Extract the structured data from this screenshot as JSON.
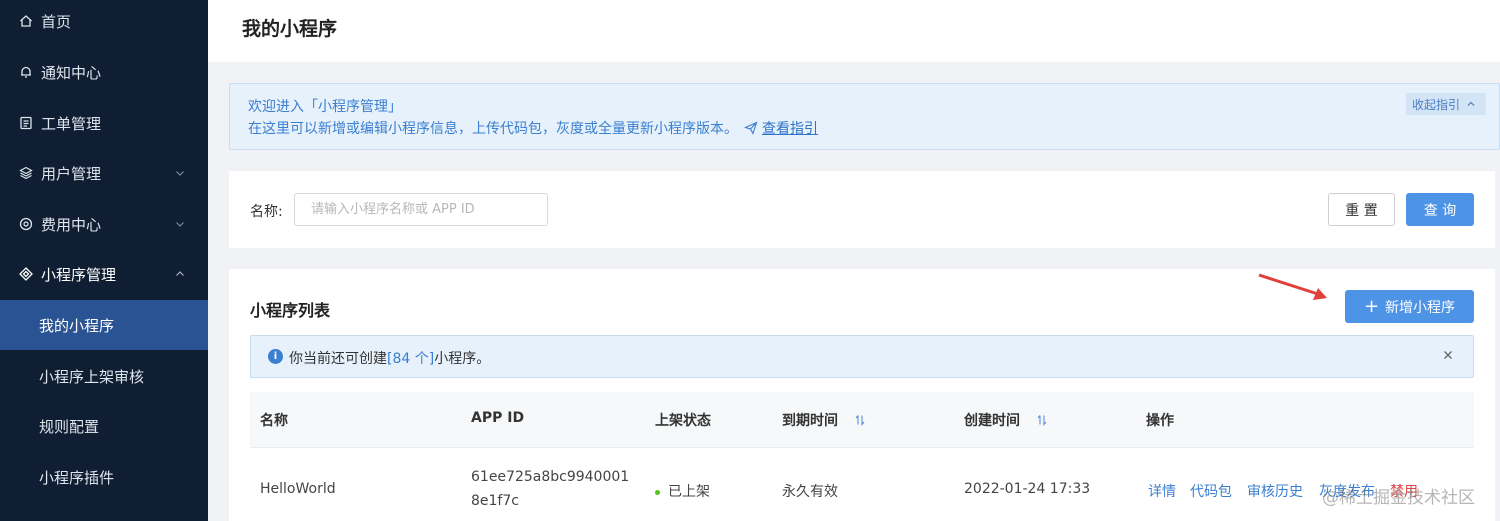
{
  "sidebar": {
    "items": [
      {
        "label": "首页",
        "icon": "home-icon"
      },
      {
        "label": "通知中心",
        "icon": "bell-icon"
      },
      {
        "label": "工单管理",
        "icon": "ticket-icon"
      },
      {
        "label": "用户管理",
        "icon": "layers-icon"
      },
      {
        "label": "费用中心",
        "icon": "coin-icon"
      },
      {
        "label": "小程序管理",
        "icon": "miniapp-icon"
      }
    ],
    "sub_items": [
      {
        "label": "我的小程序"
      },
      {
        "label": "小程序上架审核"
      },
      {
        "label": "规则配置"
      },
      {
        "label": "小程序插件"
      }
    ]
  },
  "header": {
    "title": "我的小程序"
  },
  "guide": {
    "line1": "欢迎进入「小程序管理」",
    "line2": "在这里可以新增或编辑小程序信息，上传代码包，灰度或全量更新小程序版本。",
    "link": "查看指引",
    "collapse": "收起指引"
  },
  "filter": {
    "label": "名称:",
    "placeholder": "请输入小程序名称或 APP ID",
    "reset": "重 置",
    "query": "查 询"
  },
  "list": {
    "title": "小程序列表",
    "add_button": "新增小程序",
    "notice_prefix": "你当前还可创建",
    "notice_count": "[84 个]",
    "notice_suffix": "小程序。",
    "columns": {
      "name": "名称",
      "appid": "APP ID",
      "status": "上架状态",
      "expire": "到期时间",
      "created": "创建时间",
      "ops": "操作"
    },
    "rows": [
      {
        "name": "HelloWorld",
        "appid_l1": "61ee725a8bc9940001",
        "appid_l2": "8e1f7c",
        "status": "已上架",
        "expire": "永久有效",
        "created": "2022-01-24 17:33",
        "ops": [
          "详情",
          "代码包",
          "审核历史",
          "灰度发布",
          "禁用"
        ]
      }
    ]
  },
  "watermark": "@稀土掘金技术社区",
  "colors": {
    "sidebar_bg": "#0f1e32",
    "sidebar_active": "#2a5394",
    "primary": "#4d93e6",
    "link": "#3b7fd0",
    "success": "#52c41a",
    "danger": "#e04646"
  }
}
